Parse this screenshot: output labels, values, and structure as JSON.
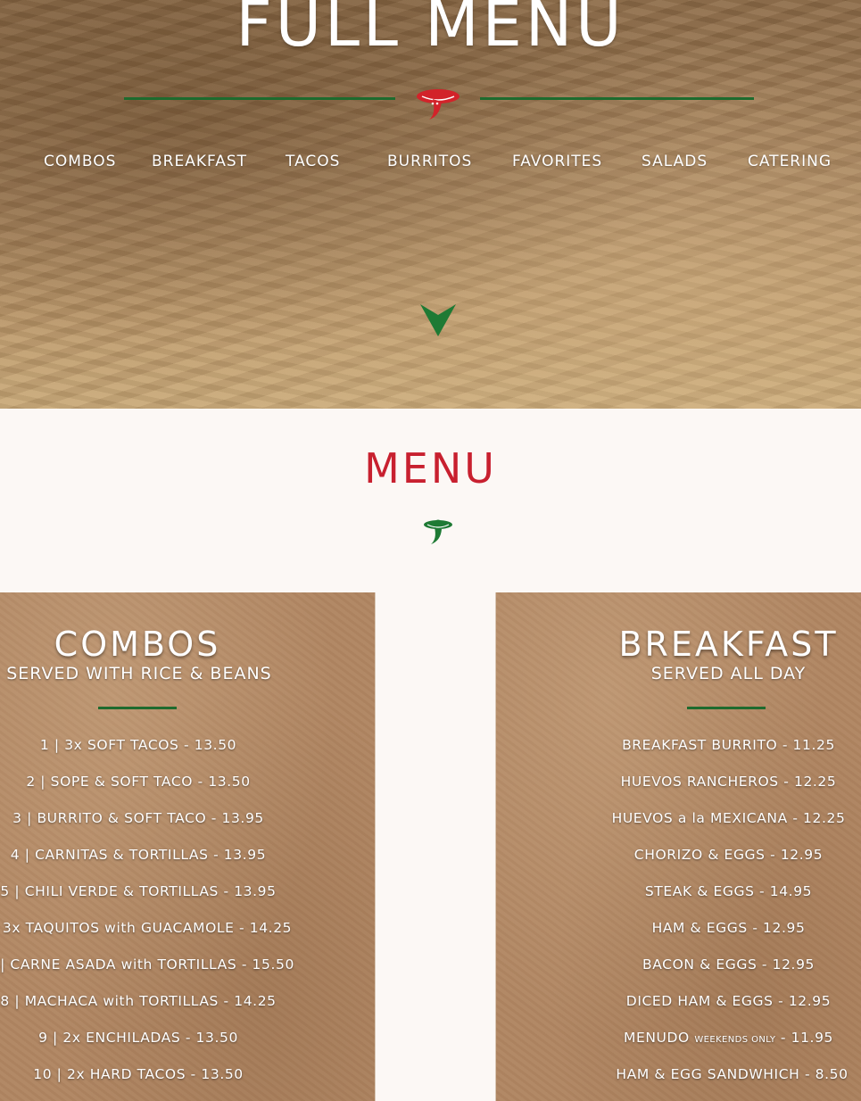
{
  "hero": {
    "title": "FULL MENU",
    "nav": [
      {
        "label": "COMBOS"
      },
      {
        "label": "BREAKFAST"
      },
      {
        "label": "TACOS"
      },
      {
        "label": "BURRITOS"
      },
      {
        "label": "FAVORITES"
      },
      {
        "label": "SALADS"
      },
      {
        "label": "CATERING"
      }
    ],
    "icons": {
      "logo": "sombrero-pepper-icon",
      "scroll": "chevron-down-icon"
    }
  },
  "menu_section": {
    "title": "MENU",
    "icon": "sombrero-pepper-icon"
  },
  "colors": {
    "accent_green": "#1e6b2e",
    "menu_red": "#c8202f",
    "page_background": "#fcf8f5",
    "panel_paper": "#b08561"
  },
  "combos": {
    "title": "COMBOS",
    "subtitle": "SERVED WITH RICE & BEANS",
    "items": [
      "1 | 3x SOFT TACOS - 13.50",
      "2 | SOPE & SOFT TACO - 13.50",
      "3 | BURRITO & SOFT TACO - 13.95",
      "4 | CARNITAS & TORTILLAS - 13.95",
      "5 | CHILI VERDE & TORTILLAS - 13.95",
      "3x TAQUITOS with GUACAMOLE - 14.25",
      "| CARNE ASADA with TORTILLAS - 15.50",
      "8 | MACHACA with TORTILLAS - 14.25",
      "9 | 2x ENCHILADAS - 13.50",
      "10 | 2x HARD TACOS - 13.50"
    ]
  },
  "breakfast": {
    "title": "BREAKFAST",
    "subtitle": "SERVED ALL DAY",
    "items": [
      "BREAKFAST BURRITO - 11.25",
      "HUEVOS RANCHEROS - 12.25",
      "HUEVOS a la MEXICANA - 12.25",
      "CHORIZO & EGGS - 12.95",
      "STEAK & EGGS - 14.95",
      "HAM & EGGS - 12.95",
      "BACON & EGGS - 12.95",
      "DICED HAM & EGGS - 12.95"
    ],
    "menudo": {
      "name": "MENUDO",
      "note": "WEEKENDS ONLY",
      "price": "- 11.95"
    },
    "last_item": "HAM & EGG SANDWHICH - 8.50"
  }
}
